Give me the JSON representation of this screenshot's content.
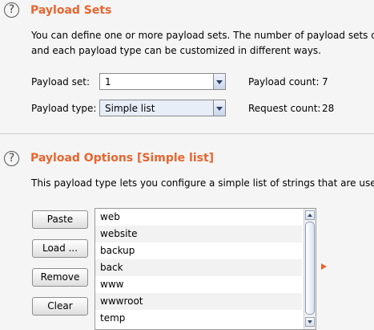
{
  "payload_sets": {
    "title": "Payload Sets",
    "description_line1": "You can define one or more payload sets. The number of payload sets dep",
    "description_line2": "and each payload type can be customized in different ways.",
    "payload_set_label": "Payload set:",
    "payload_set_value": "1",
    "payload_type_label": "Payload type:",
    "payload_type_value": "Simple list",
    "payload_count_label": "Payload count:",
    "payload_count_value": "7",
    "request_count_label": "Request count:",
    "request_count_value": "28"
  },
  "payload_options": {
    "title": "Payload Options [Simple list]",
    "description": "This payload type lets you configure a simple list of strings that are used a",
    "buttons": {
      "paste": "Paste",
      "load": "Load ...",
      "remove": "Remove",
      "clear": "Clear"
    },
    "list_items": [
      "web",
      "website",
      "backup",
      "back",
      "www",
      "wwwroot",
      "temp"
    ]
  },
  "help_icon_glyph": "?",
  "icons": [
    "help-icon",
    "dropdown-arrow-icon",
    "expand-arrow-icon",
    "scroll-up-icon",
    "scroll-down-icon"
  ],
  "colors": {
    "section_title": "#e8652e",
    "background": "#f5f5f5"
  }
}
